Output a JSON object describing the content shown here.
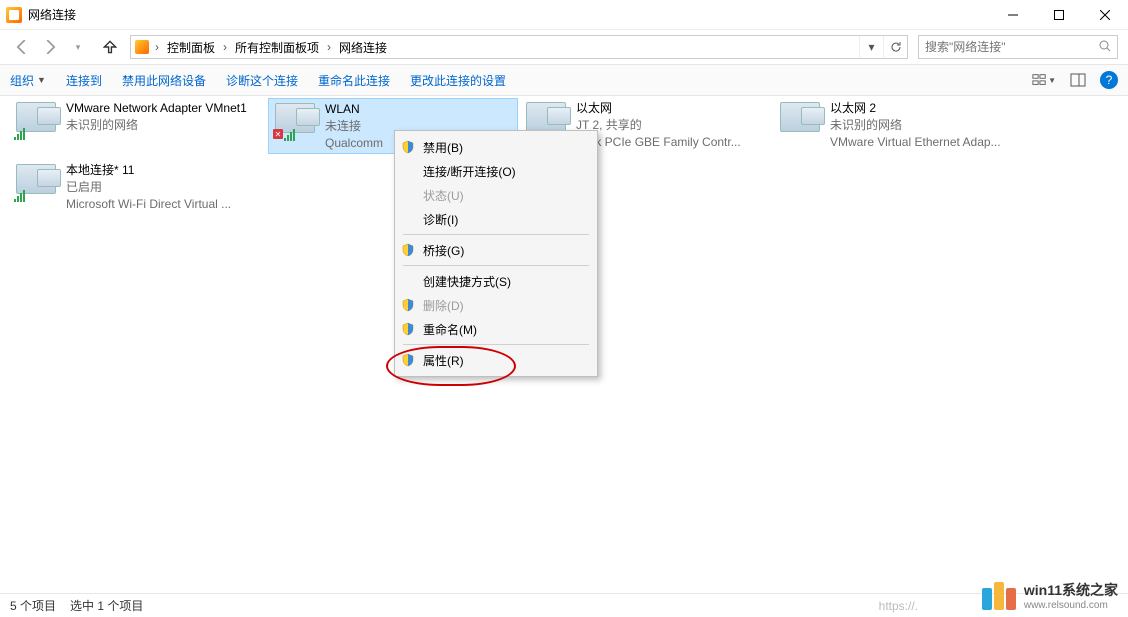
{
  "window": {
    "title": "网络连接"
  },
  "breadcrumb": {
    "root": "控制面板",
    "mid": "所有控制面板项",
    "leaf": "网络连接"
  },
  "search": {
    "placeholder": "搜索\"网络连接\""
  },
  "toolbar": {
    "organize": "组织",
    "connect": "连接到",
    "disable": "禁用此网络设备",
    "diagnose": "诊断这个连接",
    "rename": "重命名此连接",
    "change": "更改此连接的设置"
  },
  "items": [
    {
      "name": "VMware Network Adapter VMnet1",
      "sub1": "未识别的网络",
      "sub2": ""
    },
    {
      "name": "WLAN",
      "sub1": "未连接",
      "sub2": "Qualcomm"
    },
    {
      "name": "以太网",
      "sub1": "JT 2, 共享的",
      "sub2": "altek PCIe GBE Family Contr..."
    },
    {
      "name": "以太网 2",
      "sub1": "未识别的网络",
      "sub2": "VMware Virtual Ethernet Adap..."
    },
    {
      "name": "本地连接* 11",
      "sub1": "已启用",
      "sub2": "Microsoft Wi-Fi Direct Virtual ..."
    }
  ],
  "context_menu": {
    "disable": "禁用(B)",
    "connect": "连接/断开连接(O)",
    "status": "状态(U)",
    "diagnose": "诊断(I)",
    "bridge": "桥接(G)",
    "shortcut": "创建快捷方式(S)",
    "delete": "删除(D)",
    "rename": "重命名(M)",
    "properties": "属性(R)"
  },
  "status_bar": {
    "count": "5 个项目",
    "selected": "选中 1 个项目",
    "url_hint": "https://."
  },
  "watermark": {
    "line1": "win11系统之家",
    "line2": "www.relsound.com"
  }
}
